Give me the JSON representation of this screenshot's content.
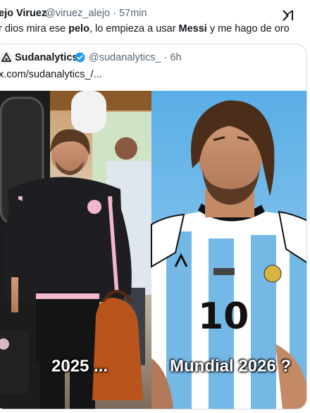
{
  "tweet": {
    "author_name": "ejo Viruez",
    "author_handle": "@viruez_alejo · 57min",
    "text_parts": [
      "r dios mira ese ",
      "pelo",
      ", lo  empieza a usar ",
      "Messi",
      " y me hago de oro"
    ]
  },
  "quote": {
    "author_name": "Sudanalytics",
    "author_handle": "@sudanalytics_ · 6h",
    "text": "x.com/sudanalytics_/..."
  },
  "media": {
    "caption_left": "2025 ...",
    "caption_right": "Mundial 2026 ?",
    "jersey_number": "10"
  },
  "icons": {
    "grok": "grok-icon",
    "verified": "verified-badge-icon",
    "avatar": "sudanalytics-avatar"
  },
  "colors": {
    "verified": "#1d9bf0",
    "handle": "#536471"
  }
}
